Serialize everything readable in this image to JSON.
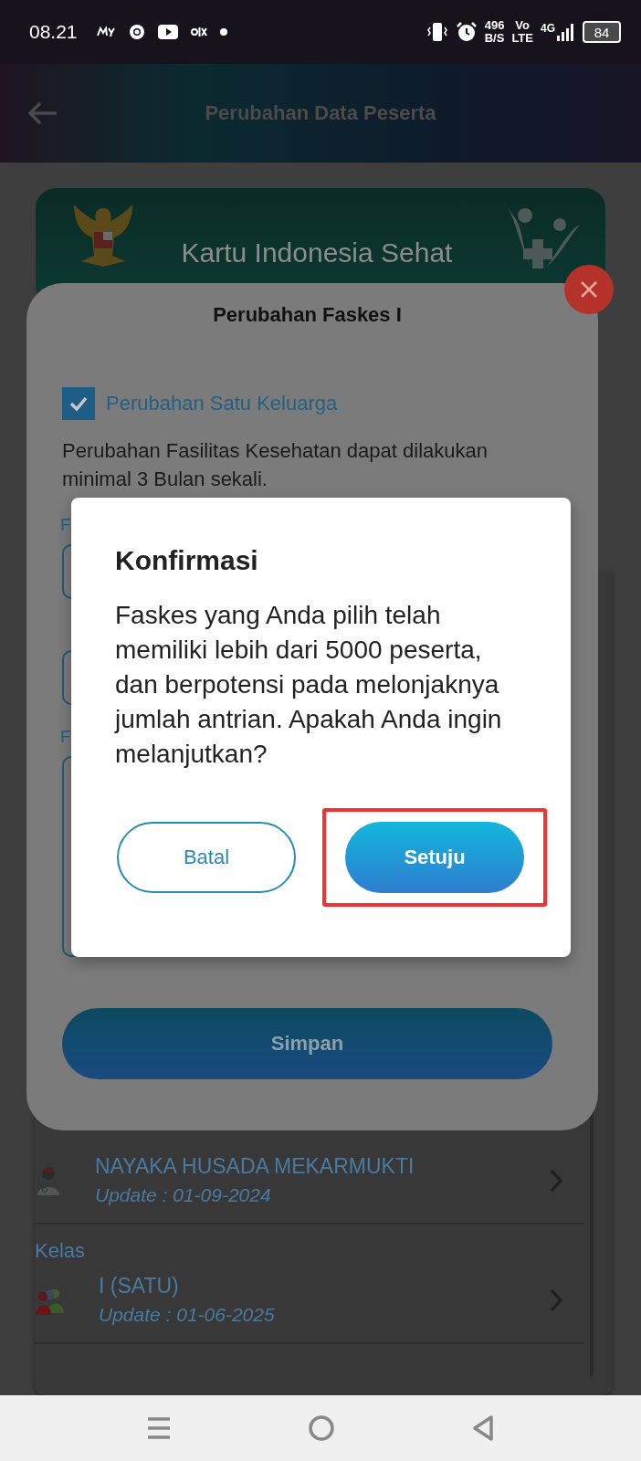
{
  "status_bar": {
    "time": "08.21",
    "net_speed": "496",
    "net_speed_unit": "B/S",
    "volte_top": "Vo",
    "volte_bottom": "LTE",
    "network": "4G",
    "battery": "84"
  },
  "header": {
    "title": "Perubahan Data Peserta"
  },
  "card": {
    "title": "Kartu Indonesia Sehat"
  },
  "list": {
    "faskes": {
      "name": "NAYAKA HUSADA MEKARMUKTI",
      "update": "Update : 01-09-2024"
    },
    "kelas": {
      "label": "Kelas",
      "name": "I (SATU)",
      "update": "Update : 01-06-2025"
    }
  },
  "sheet": {
    "title": "Perubahan Faskes I",
    "family_change": {
      "label": "Perubahan Satu Keluarga",
      "checked": true
    },
    "note": "Perubahan Fasilitas Kesehatan dapat dilakukan minimal 3 Bulan sekali.",
    "fields": [
      {
        "label": "F",
        "kind": "input"
      },
      {
        "kind": "input"
      },
      {
        "label": "F",
        "kind": "textarea"
      }
    ],
    "save_button": "Simpan"
  },
  "dialog": {
    "title": "Konfirmasi",
    "message": "Faskes yang Anda pilih telah memiliki lebih dari 5000 peserta, dan berpotensi pada melonjaknya jumlah antrian. Apakah Anda ingin melanjutkan?",
    "buttons": [
      {
        "label": "Batal",
        "kind": "outline",
        "highlighted": false
      },
      {
        "label": "Setuju",
        "kind": "primary",
        "highlighted": true
      }
    ]
  }
}
